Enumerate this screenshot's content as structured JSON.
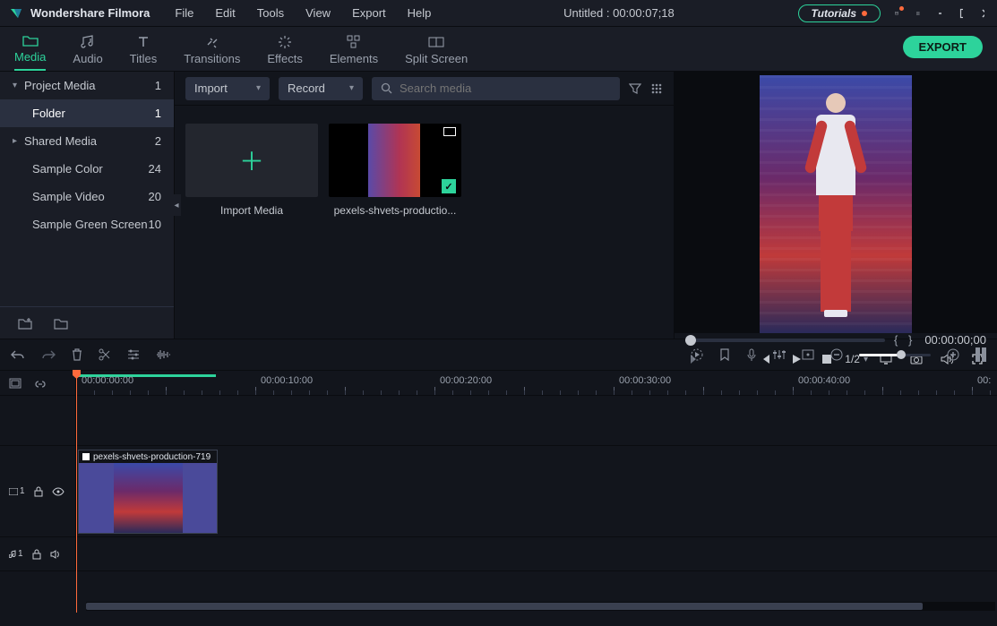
{
  "app": {
    "title": "Wondershare Filmora",
    "document_title": "Untitled : 00:00:07;18"
  },
  "menubar": [
    "File",
    "Edit",
    "Tools",
    "View",
    "Export",
    "Help"
  ],
  "titlebar_right": {
    "tutorials": "Tutorials"
  },
  "tabs": {
    "items": [
      "Media",
      "Audio",
      "Titles",
      "Transitions",
      "Effects",
      "Elements",
      "Split Screen"
    ],
    "active": "Media",
    "export": "EXPORT"
  },
  "sidebar": {
    "items": [
      {
        "label": "Project Media",
        "count": "1",
        "level": 1,
        "expander": "down"
      },
      {
        "label": "Folder",
        "count": "1",
        "level": 2,
        "active": true
      },
      {
        "label": "Shared Media",
        "count": "2",
        "level": 1,
        "expander": "right"
      },
      {
        "label": "Sample Color",
        "count": "24",
        "level": 2
      },
      {
        "label": "Sample Video",
        "count": "20",
        "level": 2
      },
      {
        "label": "Sample Green Screen",
        "count": "10",
        "level": 2
      }
    ]
  },
  "media_toolbar": {
    "import": "Import",
    "record": "Record",
    "search_placeholder": "Search media"
  },
  "media_cards": {
    "import_label": "Import Media",
    "clip_label": "pexels-shvets-productio..."
  },
  "preview": {
    "braces": "{      }",
    "timecode": "00:00:00;00",
    "ratio": "1/2"
  },
  "ruler": {
    "t0": "00:00:00:00",
    "t1": "00:00:10:00",
    "t2": "00:00:20:00",
    "t3": "00:00:30:00",
    "t4": "00:00:40:00",
    "t5": "00:"
  },
  "tracks": {
    "video_label": "1",
    "audio_label": "1",
    "clip_title": "pexels-shvets-production-719"
  }
}
